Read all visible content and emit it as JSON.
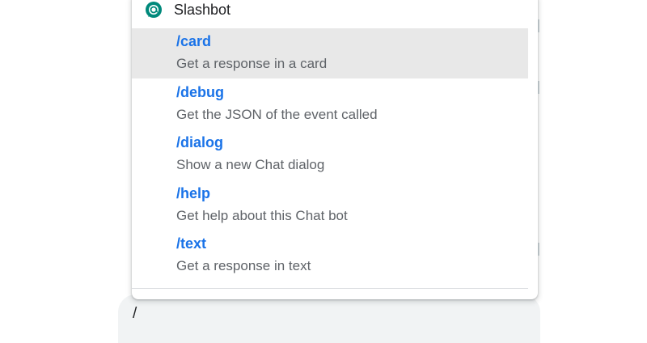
{
  "composer": {
    "value": "/"
  },
  "popup": {
    "bot_name": "Slashbot",
    "bot_icon": "chat-bot-icon",
    "accent_color": "#1a73e8",
    "commands": [
      {
        "name": "/card",
        "description": "Get a response in a card",
        "selected": true
      },
      {
        "name": "/debug",
        "description": "Get the JSON of the event called",
        "selected": false
      },
      {
        "name": "/dialog",
        "description": "Show a new Chat dialog",
        "selected": false
      },
      {
        "name": "/help",
        "description": "Get help about this Chat bot",
        "selected": false
      },
      {
        "name": "/text",
        "description": "Get a response in text",
        "selected": false
      }
    ]
  }
}
